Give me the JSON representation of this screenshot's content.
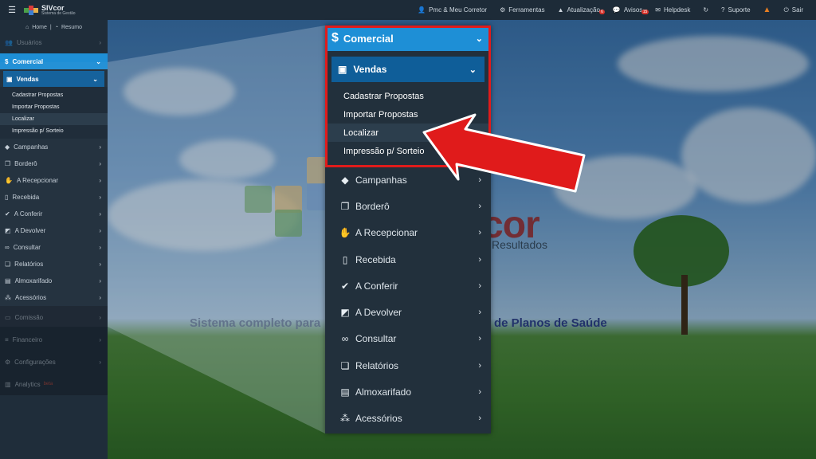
{
  "topbar": {
    "brand_name": "SIVcor",
    "brand_sub": "Sistema de Gestão",
    "items": [
      {
        "label": "Pmc & Meu Corretor",
        "icon": "user-icon"
      },
      {
        "label": "Ferramentas",
        "icon": "gears-icon"
      },
      {
        "label": "Atualização",
        "icon": "warning-icon",
        "badge": "6"
      },
      {
        "label": "Avisos",
        "icon": "comments-icon",
        "badge": "15"
      },
      {
        "label": "Helpdesk",
        "icon": "chat-icon"
      },
      {
        "label": "",
        "icon": "refresh-icon"
      },
      {
        "label": "Suporte",
        "icon": "question-icon"
      },
      {
        "label": "",
        "icon": "alert-icon"
      },
      {
        "label": "Sair",
        "icon": "power-icon"
      }
    ]
  },
  "sidebar": {
    "home_label": "Home",
    "resumo_label": "Resumo",
    "usuarios": "Usuários",
    "comercial": "Comercial",
    "vendas": "Vendas",
    "vendas_items": [
      "Cadastrar Propostas",
      "Importar Propostas",
      "Localizar",
      "Impressão p/ Sorteio"
    ],
    "items": [
      "Campanhas",
      "Borderô",
      "A Recepcionar",
      "Recebida",
      "A Conferir",
      "A Devolver",
      "Consultar",
      "Relatórios",
      "Almoxarifado",
      "Acessórios"
    ],
    "lower": [
      "Comissão",
      "Financeiro",
      "Configurações",
      "Analytics"
    ],
    "analytics_badge": "beta"
  },
  "zoom": {
    "comercial": "Comercial",
    "vendas": "Vendas",
    "vendas_items": [
      "Cadastrar Propostas",
      "Importar Propostas",
      "Localizar",
      "Impressão p/ Sorteio"
    ],
    "items": [
      "Campanhas",
      "Borderô",
      "A Recepcionar",
      "Recebida",
      "A Conferir",
      "A Devolver",
      "Consultar",
      "Relatórios",
      "Almoxarifado",
      "Acessórios"
    ]
  },
  "background": {
    "logo_text": "cor",
    "logo_sub": "Resultados",
    "tagline_left": "Sistema completo para",
    "tagline_right": "de Planos de Saúde"
  },
  "colors": {
    "accent": "#1e8fd6",
    "submenu_active": "#0f5e99",
    "highlight": "#e01b1b",
    "arrow": "#e01b1b"
  }
}
